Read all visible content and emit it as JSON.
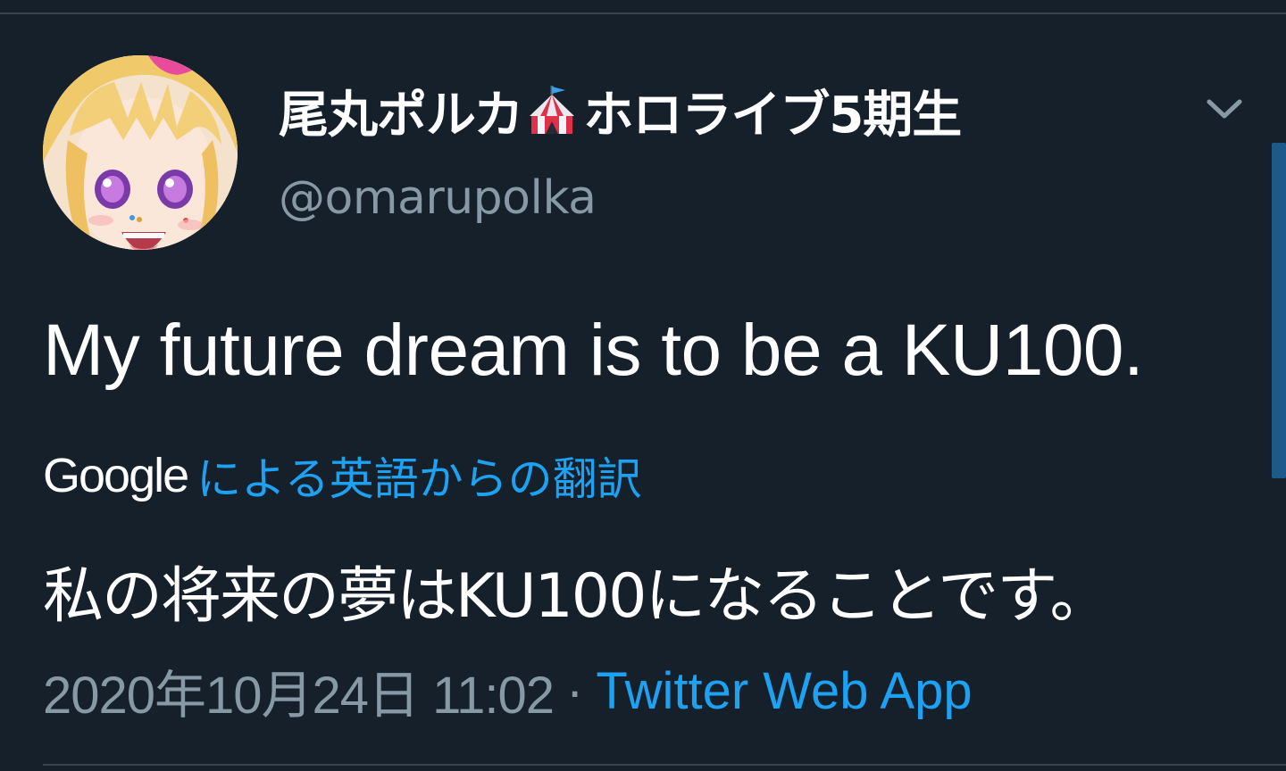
{
  "tweet": {
    "display_name_part1": "尾丸ポルカ",
    "display_name_emoji": "circus-tent-icon",
    "display_name_part2": "ホロライブ5期生",
    "handle": "@omarupolka",
    "text": "My future dream is to be a KU100.",
    "translation_provider": "Google",
    "translation_label": "による英語からの翻訳",
    "translated_text": "私の将来の夢はKU100になることです。",
    "timestamp": "2020年10月24日 11:02",
    "separator": "·",
    "source": "Twitter Web App"
  },
  "colors": {
    "background": "#15202b",
    "primary_text": "#ffffff",
    "secondary_text": "#8899a6",
    "accent": "#1da1f2",
    "divider": "#38444d"
  },
  "icons": {
    "menu": "chevron-down-icon",
    "avatar": "avatar"
  }
}
